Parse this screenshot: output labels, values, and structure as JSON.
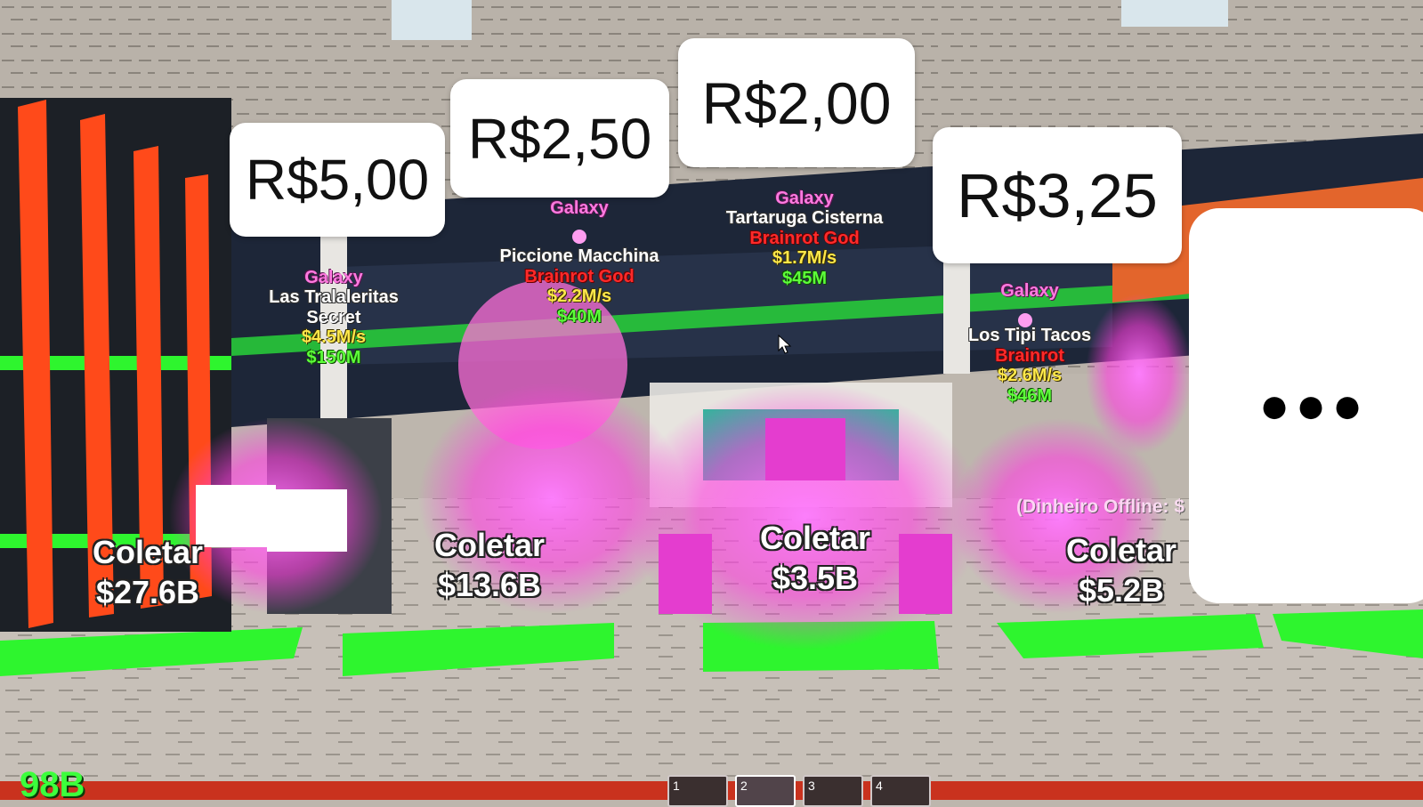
{
  "price_tags": [
    "R$5,00",
    "R$2,50",
    "R$2,00",
    "R$3,25"
  ],
  "more_button": {
    "icon": "ellipsis-icon",
    "glyph": "●●●"
  },
  "pets": [
    {
      "rarity": "Galaxy",
      "name": "Las Tralaleritas",
      "tier": "Secret",
      "rate": "$4.5M/s",
      "price": "$150M"
    },
    {
      "rarity": "Galaxy",
      "name": "Piccione Macchina",
      "tier": "Brainrot God",
      "rate": "$2.2M/s",
      "price": "$40M"
    },
    {
      "rarity": "Galaxy",
      "name": "Tartaruga Cisterna",
      "tier": "Brainrot God",
      "rate": "$1.7M/s",
      "price": "$45M"
    },
    {
      "rarity": "Galaxy",
      "name": "Los Tipi Tacos",
      "tier": "Brainrot",
      "rate": "$2.6M/s",
      "price": "$46M"
    }
  ],
  "collect": [
    {
      "label": "Coletar",
      "value": "$27.6B"
    },
    {
      "label": "Coletar",
      "value": "$13.6B"
    },
    {
      "label": "Coletar",
      "value": "$3.5B"
    },
    {
      "label": "Coletar",
      "value": "$5.2B"
    }
  ],
  "offline_text": "(Dinheiro Offline: $",
  "hotbar": [
    "1",
    "2",
    "3",
    "4"
  ],
  "bottom_cash": "98B",
  "colors": {
    "rarity_galaxy": "#ff7ae0",
    "tier_god": "#ff2a2a",
    "rate": "#ffe84a",
    "price": "#5dff3a",
    "pad_green": "#2ef52e",
    "wall_orange": "#ff4a1a"
  }
}
